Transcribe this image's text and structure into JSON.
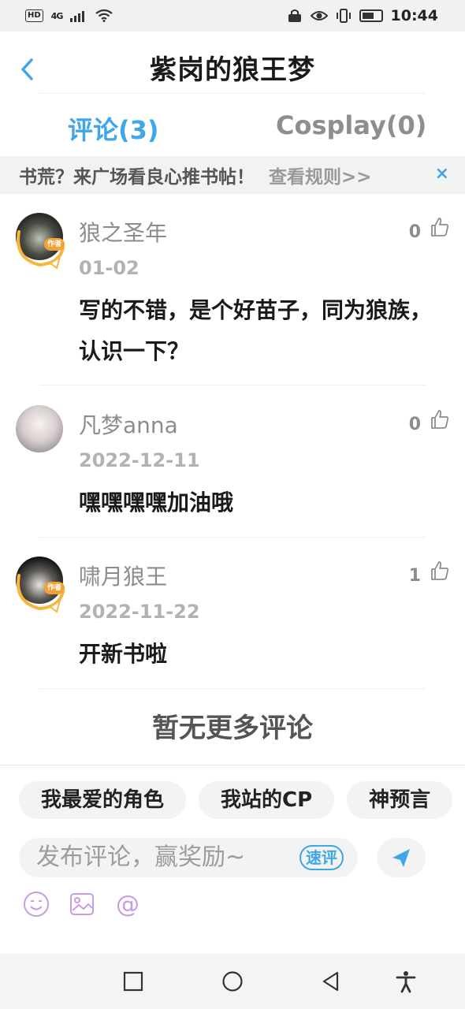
{
  "status_bar": {
    "hd": "HD",
    "network": "4G",
    "time": "10:44"
  },
  "header": {
    "title": "紫岗的狼王梦"
  },
  "tabs": [
    {
      "label": "评论(3)"
    },
    {
      "label": "Cosplay(0)"
    }
  ],
  "notice": {
    "text": "书荒？来广场看良心推书帖！",
    "link": "查看规则>>",
    "close": "×"
  },
  "comments": [
    {
      "author_badge": "作者",
      "name": "狼之圣年",
      "date": "01-02",
      "likes": "0",
      "text": "写的不错，是个好苗子，同为狼族，认识一下？"
    },
    {
      "name": "凡梦anna",
      "date": "2022-12-11",
      "likes": "0",
      "text": "嘿嘿嘿嘿加油哦"
    },
    {
      "author_badge": "作者",
      "name": "啸月狼王",
      "date": "2022-11-22",
      "likes": "1",
      "text": "开新书啦"
    }
  ],
  "no_more": "暂无更多评论",
  "composer": {
    "chips": [
      "我最爱的角色",
      "我站的CP",
      "神预言"
    ],
    "input_placeholder": "发布评论，赢奖励~",
    "quick_label": "速评"
  },
  "colors": {
    "accent": "#3fa6e8",
    "muted": "#8c8c8c"
  }
}
